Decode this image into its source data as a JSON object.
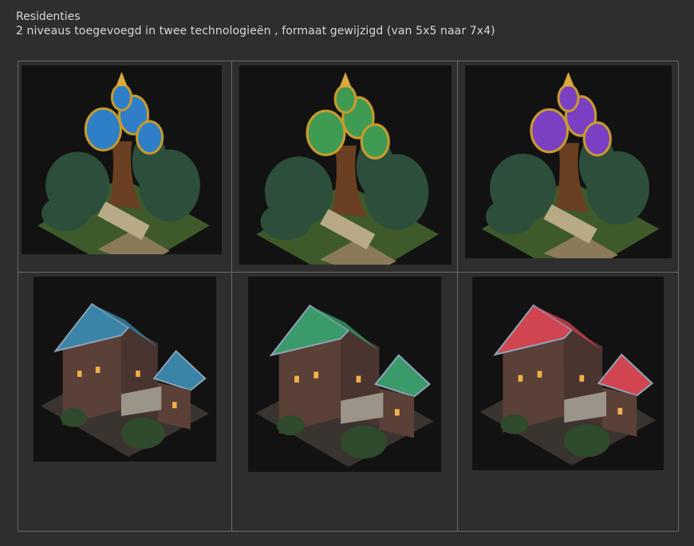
{
  "header": {
    "title": "Residenties",
    "subtitle": "2 niveaus toegevoegd  in twee technologieën , formaat gewijzigd (van 5x5 naar 7x4)"
  },
  "gallery": {
    "rows": [
      {
        "name": "tree-residences",
        "items": [
          {
            "kind": "tree",
            "accent": "#2f7fc8"
          },
          {
            "kind": "tree",
            "accent": "#3f9a52"
          },
          {
            "kind": "tree",
            "accent": "#7a3fc2"
          }
        ]
      },
      {
        "name": "manor-residences",
        "items": [
          {
            "kind": "manor",
            "accent": "#3a84a8"
          },
          {
            "kind": "manor",
            "accent": "#3a9a6a"
          },
          {
            "kind": "manor",
            "accent": "#d04550"
          }
        ]
      }
    ]
  }
}
